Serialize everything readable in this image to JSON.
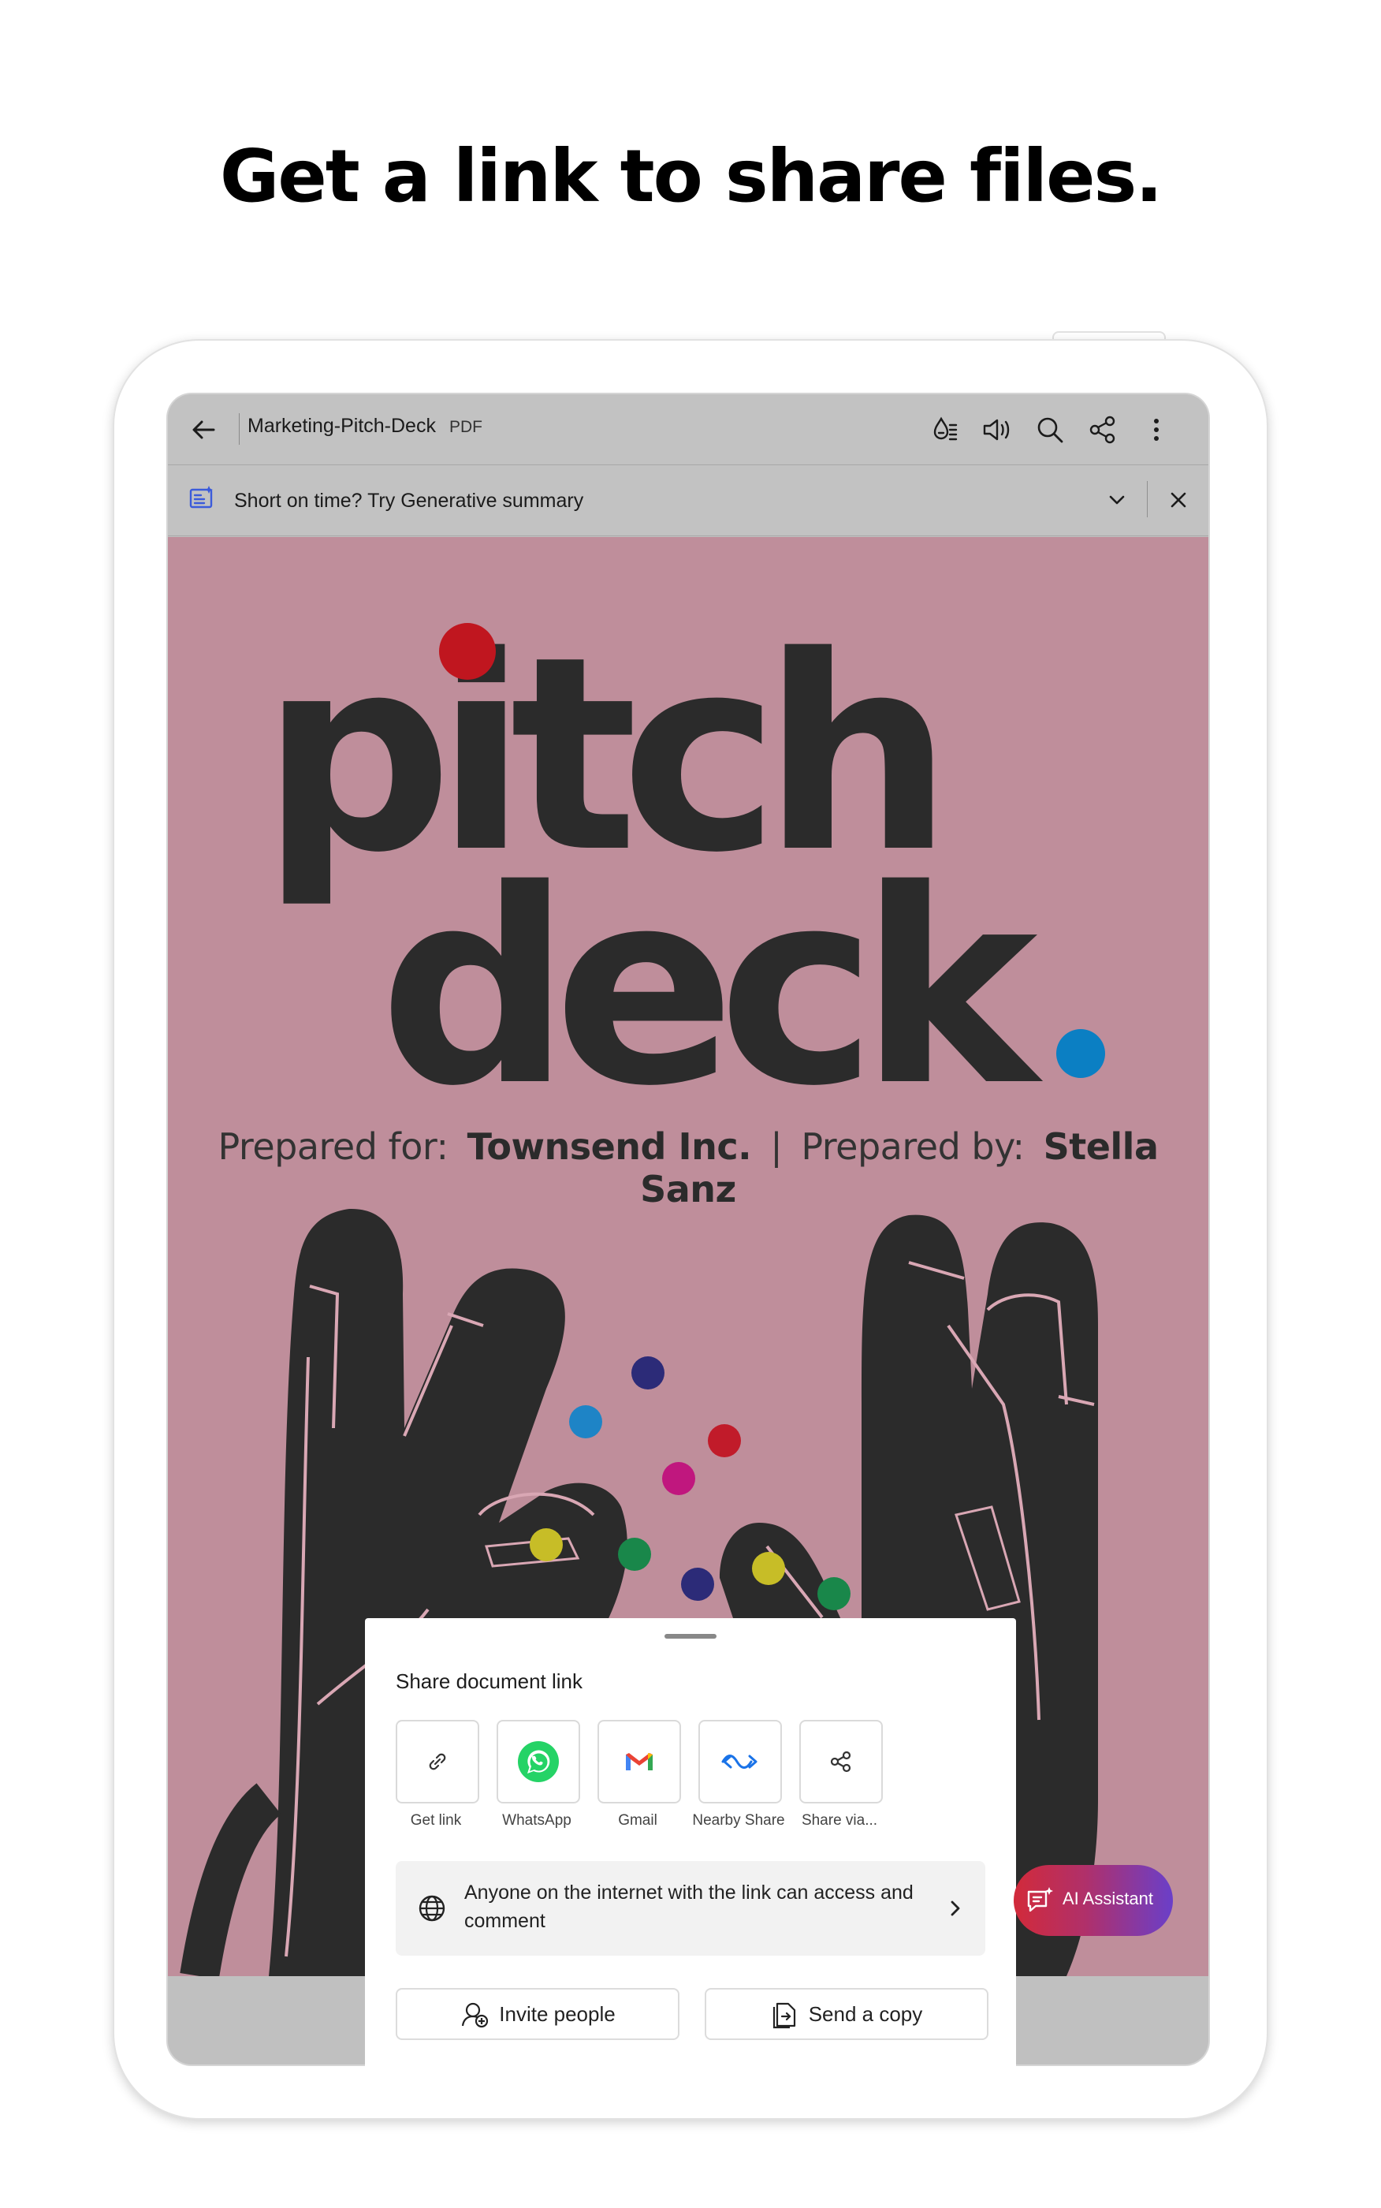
{
  "headline": "Get a link to share files.",
  "toolbar": {
    "doc_title": "Marketing-Pitch-Deck",
    "doc_type": "PDF",
    "icons": [
      "back-arrow-icon",
      "liquid-mode-icon",
      "read-aloud-icon",
      "search-icon",
      "share-icon",
      "more-icon"
    ]
  },
  "banner": {
    "text": "Short on time? Try Generative summary"
  },
  "document": {
    "word1": "pitch",
    "word2": "deck",
    "prepared_for_label": "Prepared for:",
    "prepared_for_value": "Townsend Inc.",
    "separator": "|",
    "prepared_by_label": "Prepared by:",
    "prepared_by_value": "Stella Sanz",
    "background_color": "#bf8e9b"
  },
  "share_sheet": {
    "title": "Share document link",
    "targets": [
      {
        "label": "Get link",
        "icon": "link-icon"
      },
      {
        "label": "WhatsApp",
        "icon": "whatsapp-icon"
      },
      {
        "label": "Gmail",
        "icon": "gmail-icon"
      },
      {
        "label": "Nearby Share",
        "icon": "nearby-share-icon"
      },
      {
        "label": "Share via...",
        "icon": "share-icon"
      }
    ],
    "access_text": "Anyone on the internet with the link can access and comment",
    "invite_label": "Invite people",
    "send_copy_label": "Send a copy"
  },
  "ai_assistant": {
    "label": "AI Assistant"
  },
  "colors": {
    "accent_red": "#d22a3a",
    "accent_purple": "#6a3fc9",
    "dot_red": "#c0161f",
    "dot_blue": "#0b7fc3"
  }
}
